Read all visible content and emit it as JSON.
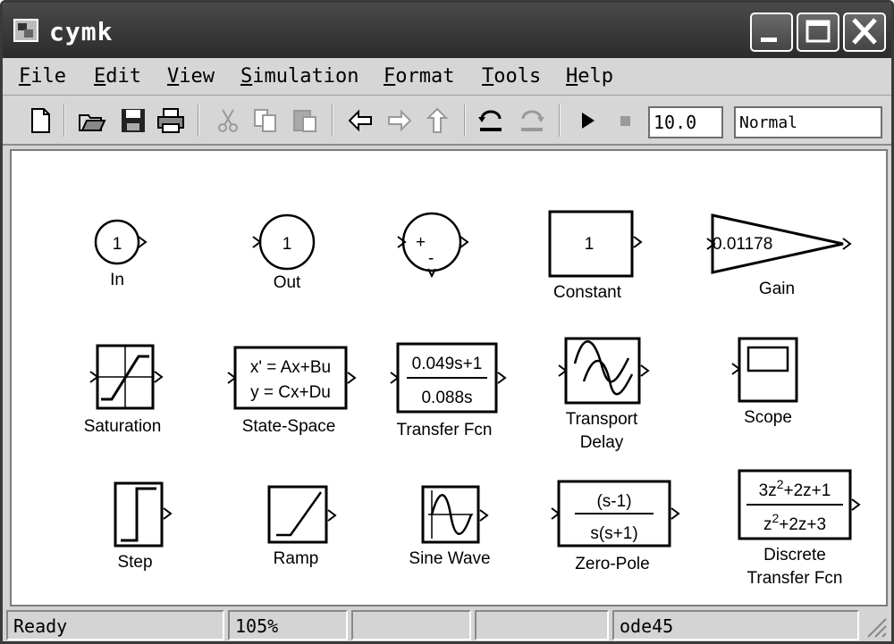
{
  "window": {
    "title": "cymk"
  },
  "menu": [
    "File",
    "Edit",
    "View",
    "Simulation",
    "Format",
    "Tools",
    "Help"
  ],
  "toolbar": {
    "buttons": [
      "new-file-icon",
      "open-folder-icon",
      "save-icon",
      "print-icon",
      "cut-icon",
      "copy-icon",
      "paste-icon",
      "back-arrow-icon",
      "forward-arrow-icon",
      "up-arrow-icon",
      "undo-icon",
      "redo-icon",
      "play-icon",
      "stop-icon"
    ],
    "stop_time": "10.0",
    "sim_mode": "Normal"
  },
  "blocks": {
    "in": {
      "label": "In",
      "port": "1"
    },
    "out": {
      "label": "Out",
      "port": "1"
    },
    "sum": {
      "signs": [
        "+",
        "-"
      ]
    },
    "constant": {
      "label": "Constant",
      "value": "1"
    },
    "gain": {
      "label": "Gain",
      "value": "0.01178"
    },
    "saturation": {
      "label": "Saturation"
    },
    "state_space": {
      "label": "State-Space",
      "line1": "x' = Ax+Bu",
      "line2": "y = Cx+Du"
    },
    "transfer_fcn": {
      "label": "Transfer Fcn",
      "num": "0.049s+1",
      "den": "0.088s"
    },
    "transport_delay": {
      "label1": "Transport",
      "label2": "Delay"
    },
    "scope": {
      "label": "Scope"
    },
    "step": {
      "label": "Step"
    },
    "ramp": {
      "label": "Ramp"
    },
    "sine_wave": {
      "label": "Sine Wave"
    },
    "zero_pole": {
      "label": "Zero-Pole",
      "num": "(s-1)",
      "den": "s(s+1)"
    },
    "discrete_tf": {
      "label1": "Discrete",
      "label2": "Transfer Fcn",
      "num_a": "3z",
      "num_exp": "2",
      "num_b": "+2z+1",
      "den_a": "z",
      "den_exp": "2",
      "den_b": "+2z+3"
    }
  },
  "status": {
    "state": "Ready",
    "zoom": "105%",
    "empty1": "",
    "empty2": "",
    "solver": "ode45"
  },
  "colors": {
    "title_bg": "#2b2b2b",
    "chrome": "#d4d4d4",
    "canvas": "#ffffff"
  }
}
